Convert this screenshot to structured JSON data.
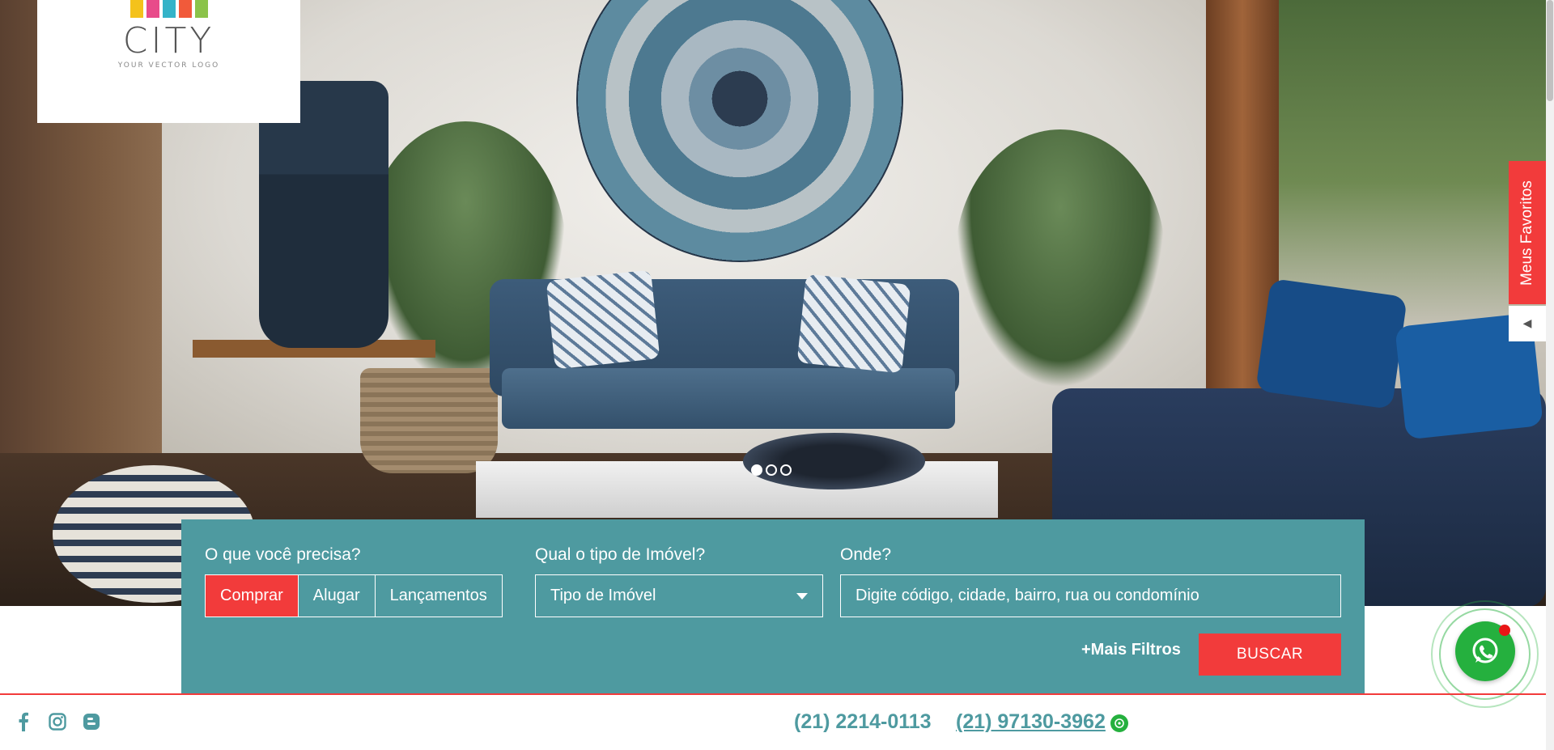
{
  "logo": {
    "name": "CITY",
    "tagline": "YOUR VECTOR LOGO",
    "bar_colors": [
      "#f4c21b",
      "#e84b8a",
      "#34b3c8",
      "#f15a3a",
      "#8bc34a"
    ]
  },
  "hero": {
    "slider": {
      "slide_count": 3,
      "active_index": 0
    }
  },
  "favorites": {
    "tab_label": "Meus Favoritos",
    "toggle_icon": "caret-left-icon"
  },
  "search": {
    "purpose_label": "O que você precisa?",
    "purpose_options": [
      {
        "label": "Comprar",
        "active": true
      },
      {
        "label": "Alugar",
        "active": false
      },
      {
        "label": "Lançamentos",
        "active": false
      }
    ],
    "type_label": "Qual o tipo de Imóvel?",
    "type_value": "Tipo de Imóvel",
    "where_label": "Onde?",
    "where_placeholder": "Digite código, cidade, bairro, rua ou condomínio",
    "more_filters": "+Mais Filtros",
    "submit": "BUSCAR"
  },
  "footer": {
    "social_icons": [
      "facebook-icon",
      "instagram-icon",
      "blogger-icon"
    ],
    "phone_landline": "(21) 2214-0113",
    "phone_whatsapp": "(21) 97130-3962"
  },
  "colors": {
    "accent": "#f23b3b",
    "teal": "#4e9aa0",
    "whatsapp": "#25b03e"
  }
}
